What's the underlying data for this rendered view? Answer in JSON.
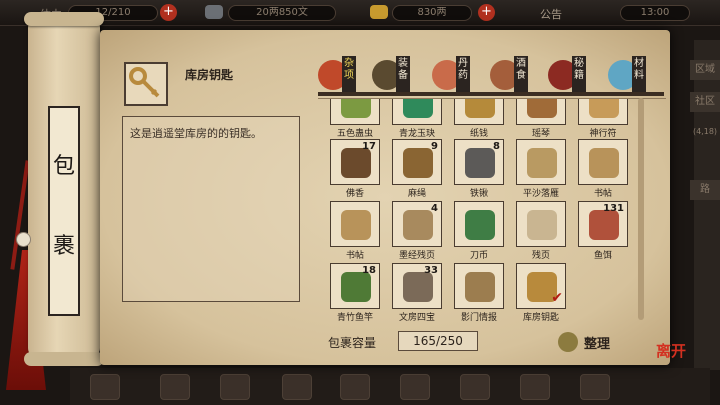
{
  "topbar": {
    "stamina": "12/210",
    "money_wen": "20两850文",
    "money_liang": "830两",
    "notice": "公告",
    "time": "13:00"
  },
  "right_labels": [
    "区域",
    "社区",
    "路"
  ],
  "right_coords": "(4,18)",
  "scroll_title": [
    "包",
    "裹"
  ],
  "selected_item": {
    "name": "库房钥匙",
    "description": "这是逍遥堂库房的的钥匙。"
  },
  "tabs": [
    {
      "label": "杂项",
      "active": true,
      "icon": "mixed-items-icon",
      "color": "#c0492a"
    },
    {
      "label": "装备",
      "active": false,
      "icon": "equipment-icon",
      "color": "#5a4a30"
    },
    {
      "label": "丹药",
      "active": false,
      "icon": "pill-icon",
      "color": "#c96b4a"
    },
    {
      "label": "酒食",
      "active": false,
      "icon": "food-icon",
      "color": "#a45e3b"
    },
    {
      "label": "秘籍",
      "active": false,
      "icon": "manual-icon",
      "color": "#8c2a22"
    },
    {
      "label": "材料",
      "active": false,
      "icon": "material-icon",
      "color": "#5fa6c4"
    }
  ],
  "items": [
    {
      "name": "五色蛊虫",
      "qty": "",
      "color": "#7c9a41"
    },
    {
      "name": "青龙玉玦",
      "qty": "",
      "color": "#2f8a5b"
    },
    {
      "name": "纸钱",
      "qty": "",
      "color": "#b58a3a"
    },
    {
      "name": "瑶琴",
      "qty": "",
      "color": "#a06b38"
    },
    {
      "name": "神行符",
      "qty": "",
      "color": "#c79b59"
    },
    {
      "name": "佛香",
      "qty": "17",
      "color": "#6b4a2c"
    },
    {
      "name": "麻绳",
      "qty": "9",
      "color": "#8a6533"
    },
    {
      "name": "铁锹",
      "qty": "8",
      "color": "#5c5a58"
    },
    {
      "name": "平沙落雁",
      "qty": "",
      "color": "#b99a62"
    },
    {
      "name": "书帖",
      "qty": "",
      "color": "#b8935a"
    },
    {
      "name": "书帖",
      "qty": "",
      "color": "#b8935a"
    },
    {
      "name": "墨经残页",
      "qty": "4",
      "color": "#a88a5e"
    },
    {
      "name": "刀币",
      "qty": "",
      "color": "#3f7d45"
    },
    {
      "name": "残页",
      "qty": "",
      "color": "#c9b591"
    },
    {
      "name": "鱼饵",
      "qty": "131",
      "color": "#b0513b"
    },
    {
      "name": "青竹鱼竿",
      "qty": "18",
      "color": "#4f7a36"
    },
    {
      "name": "文房四宝",
      "qty": "33",
      "color": "#7b6a58"
    },
    {
      "name": "影门情报",
      "qty": "",
      "color": "#9c7d4f"
    },
    {
      "name": "库房钥匙",
      "qty": "",
      "color": "#b88a3c",
      "selected": true
    }
  ],
  "capacity": {
    "label": "包裹容量",
    "value": "165/250"
  },
  "sort_label": "整理",
  "leave_label": "离开"
}
